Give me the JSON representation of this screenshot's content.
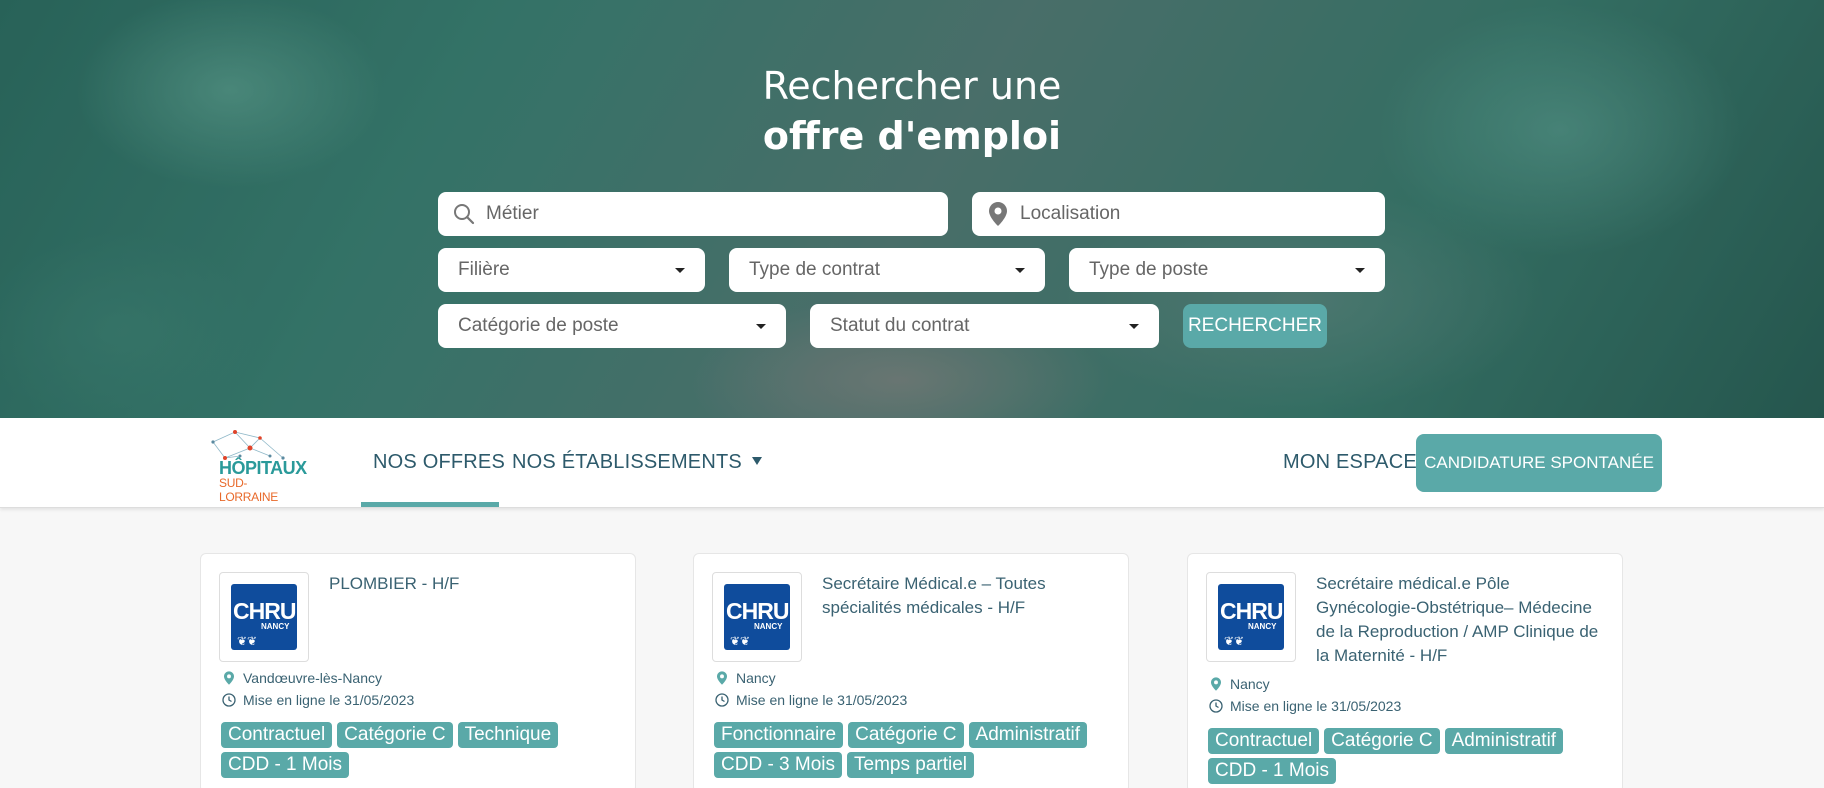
{
  "hero": {
    "title_line1": "Rechercher une",
    "title_line2": "offre d'emploi"
  },
  "search": {
    "metier_placeholder": "Métier",
    "localisation_placeholder": "Localisation",
    "filiere": "Filière",
    "type_contrat": "Type de contrat",
    "type_poste": "Type de poste",
    "categorie_poste": "Catégorie de poste",
    "statut_contrat": "Statut du contrat",
    "button": "RECHERCHER"
  },
  "nav": {
    "logo_text_1": "HÔPITAUX",
    "logo_text_2": "SUD-LORRAINE",
    "offres": "NOS OFFRES",
    "etablissements": "NOS ÉTABLISSEMENTS",
    "espace": "MON ESPACE",
    "candidature": "CANDIDATURE SPONTANÉE"
  },
  "colors": {
    "accent": "#5aa9a8",
    "text": "#2d5a6b",
    "chru_blue": "#0f4c9c"
  },
  "cards": [
    {
      "logo": {
        "line1": "CHRU",
        "line2": "NANCY"
      },
      "title": "PLOMBIER - H/F",
      "location": "Vandœuvre-lès-Nancy",
      "posted": "Mise en ligne le 31/05/2023",
      "tags": [
        "Contractuel",
        "Catégorie C",
        "Technique",
        "CDD - 1 Mois"
      ]
    },
    {
      "logo": {
        "line1": "CHRU",
        "line2": "NANCY"
      },
      "title": "Secrétaire Médical.e  – Toutes spécialités médicales - H/F",
      "location": "Nancy",
      "posted": "Mise en ligne le 31/05/2023",
      "tags": [
        "Fonctionnaire",
        "Catégorie C",
        "Administratif",
        "CDD - 3 Mois",
        "Temps partiel"
      ]
    },
    {
      "logo": {
        "line1": "CHRU",
        "line2": "NANCY"
      },
      "title": "Secrétaire médical.e Pôle Gynécologie-Obstétrique– Médecine de la Reproduction / AMP Clinique de la Maternité - H/F",
      "location": "Nancy",
      "posted": "Mise en ligne le 31/05/2023",
      "tags": [
        "Contractuel",
        "Catégorie C",
        "Administratif",
        "CDD - 1 Mois"
      ]
    }
  ]
}
